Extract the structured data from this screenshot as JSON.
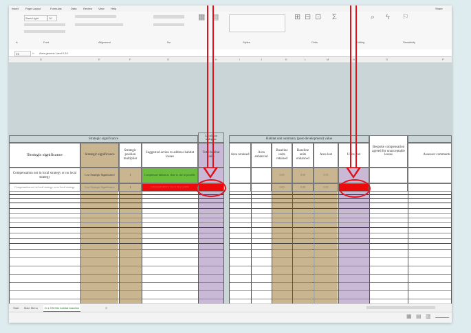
{
  "menu": [
    "Insert",
    "Page Layout",
    "Formulas",
    "Data",
    "Review",
    "View",
    "Help"
  ],
  "menu_right": "Share",
  "ribbon": {
    "font_name": "Sans Light",
    "font_size": "10",
    "alignment_label": "Alignment",
    "font_label": "Font",
    "styles_label": "Styles",
    "cells_label": "Cells",
    "editing_label": "Editing",
    "sens_label": "Sensitivity"
  },
  "formula_bar": {
    "cell_ref": "E5",
    "content": "Area generic Land 0-10"
  },
  "columns": [
    "D",
    "E",
    "F",
    "G",
    "H",
    "I",
    "J",
    "K",
    "L",
    "M",
    "N",
    "O",
    "P"
  ],
  "left_table": {
    "group_header": "Strategic significance",
    "small_header": "Calculation multiplier",
    "headers": [
      "Strategic significance",
      "Strategic significance",
      "Strategic position multiplier",
      "Suggested action to address habitat losses",
      "Total habitat units"
    ],
    "rows": [
      [
        "Compensation not in local strategy or no local strategy",
        "Low Strategic Significance",
        "1",
        "Compensate habitat as close to site as possible"
      ],
      [
        "Compensation not in local strategy or no local strategy",
        "Low Strategic Significance",
        "1",
        "Compensate habitat as close to site as possible"
      ]
    ]
  },
  "right_table": {
    "group_header": "Habitat unit summary (post-development) value",
    "bespoke_header": "Bespoke compensation agreed for unacceptable losses",
    "headers": [
      "Area retained",
      "Area enhanced",
      "Baseline units retained",
      "Baseline units enhanced",
      "Area lost",
      "Units lost",
      "Assessor comments"
    ],
    "rows": [
      [
        "",
        "",
        "0.00",
        "0.00",
        "0.35",
        ""
      ],
      [
        "",
        "",
        "0.00",
        "0.00",
        "0.35",
        ""
      ]
    ]
  },
  "sheet_tabs": [
    "Start",
    "Main Menu",
    "D-1 Off-Site habitat baseline"
  ],
  "colors": {
    "tan": "#c9b58f",
    "green": "#6bbd3d",
    "red": "#ee0a0a",
    "lavender": "#c9b9d7",
    "annotation": "#e0111a"
  }
}
